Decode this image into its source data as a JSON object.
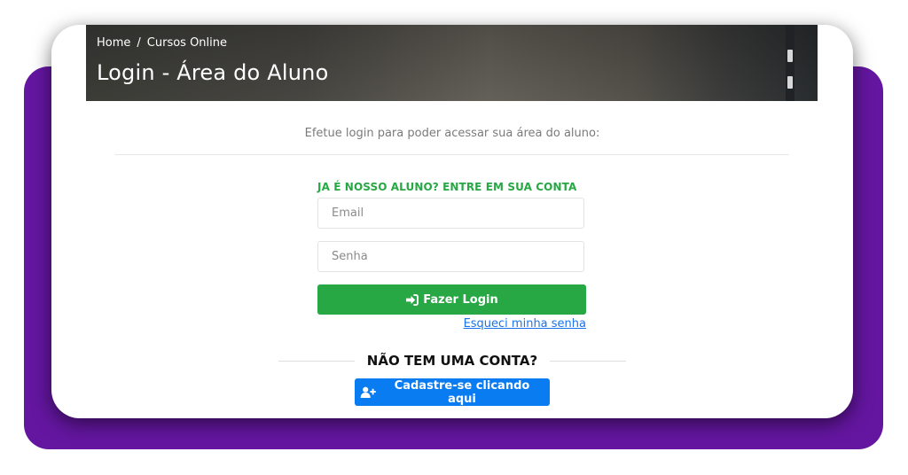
{
  "breadcrumb": {
    "home": "Home",
    "separator": "/",
    "current": "Cursos Online"
  },
  "page_title": "Login - Área do Aluno",
  "subtitle": "Efetue login para poder acessar sua área do aluno:",
  "login_form": {
    "heading": "JA É NOSSO ALUNO? ENTRE EM SUA CONTA",
    "email_placeholder": "Email",
    "password_placeholder": "Senha",
    "login_button_label": "Fazer Login",
    "login_icon": "sign-in-icon",
    "forgot_password": "Esqueci minha senha"
  },
  "signup": {
    "prompt": "NÃO TEM UMA CONTA?",
    "button_label": "Cadastre-se clicando aqui",
    "button_icon": "user-plus-icon"
  },
  "colors": {
    "frame_purple": "#6416a0",
    "success_green": "#28a745",
    "primary_blue": "#0a7cf1",
    "link_blue": "#1a73e8"
  }
}
